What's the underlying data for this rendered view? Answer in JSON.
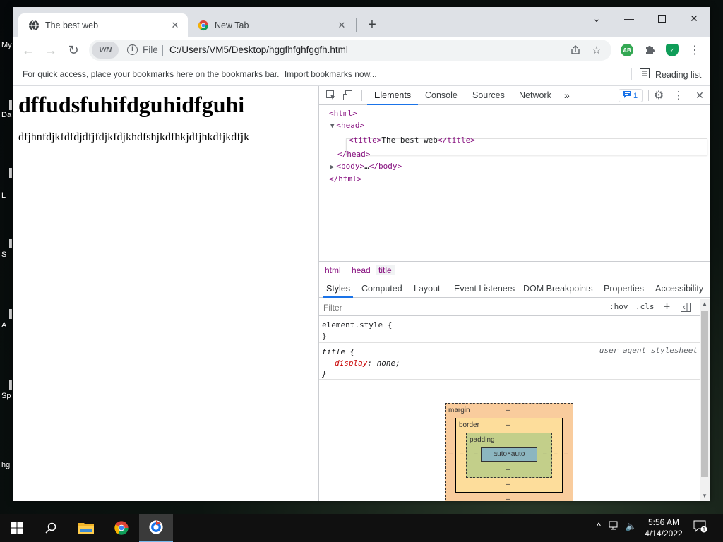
{
  "desktop": {
    "labels": [
      "My",
      "Da",
      "L",
      "S",
      "A",
      "Sp",
      "hg"
    ]
  },
  "browser": {
    "tabs": [
      {
        "title": "The best web",
        "active": true
      },
      {
        "title": "New Tab",
        "active": false
      }
    ],
    "address": {
      "scheme_label": "File",
      "url": "C:/Users/VM5/Desktop/hggfhfghfggfh.html",
      "vpn_label": "V/N"
    },
    "extensions": [
      {
        "name": "AB",
        "color": "#34a853"
      },
      {
        "name": "puzzle-icon",
        "color": "#5f6368"
      },
      {
        "name": "shield-check",
        "color": "#0f9d58"
      }
    ],
    "bookmarks_bar": {
      "hint": "For quick access, place your bookmarks here on the bookmarks bar.",
      "import_link": "Import bookmarks now...",
      "reading_list": "Reading list"
    }
  },
  "page": {
    "heading": "dffudsfuhifdguhidfguhi",
    "paragraph": "dfjhnfdjkfdfdjdfjfdjkfdjkhdfshjkdfhkjdfjhkdfjkdfjk"
  },
  "devtools": {
    "tabs": [
      "Elements",
      "Console",
      "Sources",
      "Network"
    ],
    "more_label": "»",
    "issues_count": "1",
    "dom": {
      "html_open": "<html>",
      "head_open": "<head>",
      "title_open": "<title>",
      "title_text": "The best web",
      "title_close": "</title>",
      "head_close": "</head>",
      "body_open": "<body>",
      "body_ellipsis": "…",
      "body_close": "</body>",
      "html_close": "</html>"
    },
    "breadcrumbs": [
      "html",
      "head",
      "title"
    ],
    "styles_tabs": [
      "Styles",
      "Computed",
      "Layout",
      "Event Listeners",
      "DOM Breakpoints",
      "Properties",
      "Accessibility"
    ],
    "filter": {
      "placeholder": "Filter",
      "hov": ":hov",
      "cls": ".cls"
    },
    "rules": {
      "element_style_selector": "element.style {",
      "close_brace": "}",
      "title_selector": "title {",
      "ua_source": "user agent stylesheet",
      "prop_name": "display",
      "prop_value": "none;"
    },
    "box_model": {
      "margin_label": "margin",
      "border_label": "border",
      "padding_label": "padding",
      "content": "auto×auto",
      "dash": "–"
    }
  },
  "taskbar": {
    "time": "5:56 AM",
    "date": "4/14/2022",
    "notification_count": "1"
  }
}
